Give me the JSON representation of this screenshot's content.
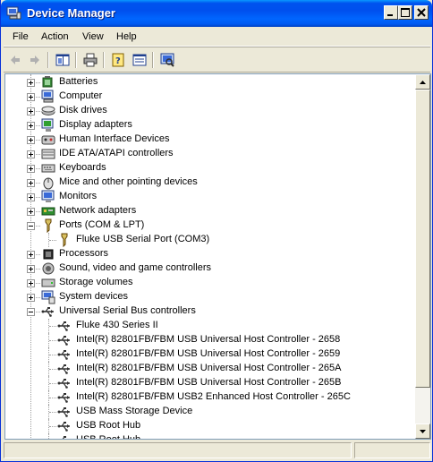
{
  "window": {
    "title": "Device Manager",
    "controls": {
      "minimize": "minimize",
      "maximize": "maximize",
      "close": "close"
    }
  },
  "menu": [
    "File",
    "Action",
    "View",
    "Help"
  ],
  "toolbar": {
    "buttons": [
      "back-arrow-icon",
      "forward-arrow-icon",
      "show-hide-console-tree-icon",
      "print-icon",
      "help-icon",
      "properties-icon",
      "scan-hardware-icon"
    ]
  },
  "tree": {
    "categories": [
      {
        "label": "Batteries",
        "icon": "battery-icon",
        "expanded": false
      },
      {
        "label": "Computer",
        "icon": "computer-icon",
        "expanded": false
      },
      {
        "label": "Disk drives",
        "icon": "disk-drive-icon",
        "expanded": false
      },
      {
        "label": "Display adapters",
        "icon": "display-adapter-icon",
        "expanded": false
      },
      {
        "label": "Human Interface Devices",
        "icon": "hid-icon",
        "expanded": false
      },
      {
        "label": "IDE ATA/ATAPI controllers",
        "icon": "ide-controller-icon",
        "expanded": false
      },
      {
        "label": "Keyboards",
        "icon": "keyboard-icon",
        "expanded": false
      },
      {
        "label": "Mice and other pointing devices",
        "icon": "mouse-icon",
        "expanded": false
      },
      {
        "label": "Monitors",
        "icon": "monitor-icon",
        "expanded": false
      },
      {
        "label": "Network adapters",
        "icon": "network-adapter-icon",
        "expanded": false
      },
      {
        "label": "Ports (COM & LPT)",
        "icon": "port-icon",
        "expanded": true
      },
      {
        "label": "Fluke USB Serial Port (COM3)",
        "icon": "port-icon",
        "child": true
      },
      {
        "label": "Processors",
        "icon": "processor-icon",
        "expanded": false
      },
      {
        "label": "Sound, video and game controllers",
        "icon": "sound-icon",
        "expanded": false
      },
      {
        "label": "Storage volumes",
        "icon": "storage-volume-icon",
        "expanded": false
      },
      {
        "label": "System devices",
        "icon": "system-device-icon",
        "expanded": false
      },
      {
        "label": "Universal Serial Bus controllers",
        "icon": "usb-icon",
        "expanded": true
      },
      {
        "label": "Fluke 430 Series II",
        "icon": "usb-icon",
        "child": true
      },
      {
        "label": "Intel(R) 82801FB/FBM USB Universal Host Controller - 2658",
        "icon": "usb-icon",
        "child": true
      },
      {
        "label": "Intel(R) 82801FB/FBM USB Universal Host Controller - 2659",
        "icon": "usb-icon",
        "child": true
      },
      {
        "label": "Intel(R) 82801FB/FBM USB Universal Host Controller - 265A",
        "icon": "usb-icon",
        "child": true
      },
      {
        "label": "Intel(R) 82801FB/FBM USB Universal Host Controller - 265B",
        "icon": "usb-icon",
        "child": true
      },
      {
        "label": "Intel(R) 82801FB/FBM USB2 Enhanced Host Controller - 265C",
        "icon": "usb-icon",
        "child": true
      },
      {
        "label": "USB Mass Storage Device",
        "icon": "usb-icon",
        "child": true
      },
      {
        "label": "USB Root Hub",
        "icon": "usb-icon",
        "child": true
      },
      {
        "label": "USB Root Hub",
        "icon": "usb-icon",
        "child": true
      }
    ]
  },
  "status": {
    "pane1": "",
    "pane2": ""
  }
}
